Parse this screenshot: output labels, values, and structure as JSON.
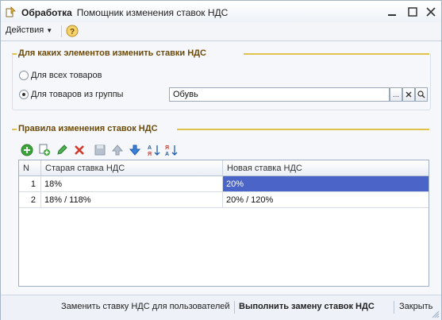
{
  "window": {
    "title_bold": "Обработка",
    "title_rest": "Помощник изменения ставок НДС",
    "icon": "processing-icon"
  },
  "menu": {
    "actions_label": "Действия",
    "help_icon": "help-icon"
  },
  "group1": {
    "title": "Для каких элементов изменить ставки НДС",
    "radio_all_label": "Для всех товаров",
    "radio_group_label": "Для товаров из группы",
    "selected": "group",
    "group_value": "Обувь",
    "buttons": [
      "...",
      "×",
      "search"
    ]
  },
  "group2": {
    "title": "Правила изменения ставок НДС",
    "toolbar_icons": [
      "add-icon",
      "copy-icon",
      "edit-icon",
      "delete-icon",
      "save-icon",
      "move-up-icon",
      "move-down-icon",
      "sort-asc-icon",
      "sort-desc-icon"
    ]
  },
  "table": {
    "columns": [
      "N",
      "Старая ставка НДС",
      "Новая ставка НДС"
    ],
    "rows": [
      {
        "n": "1",
        "old": "18%",
        "new": "20%",
        "selected_cell": "new"
      },
      {
        "n": "2",
        "old": "18% / 118%",
        "new": "20% / 120%"
      }
    ]
  },
  "footer": {
    "replace_for_users": "Заменить ставку НДС для пользователей",
    "execute": "Выполнить замену ставок НДС",
    "close": "Закрыть"
  },
  "colors": {
    "accent_line": "#e0c14b",
    "selection": "#4a64c8",
    "group_title": "#6b4a0a"
  }
}
